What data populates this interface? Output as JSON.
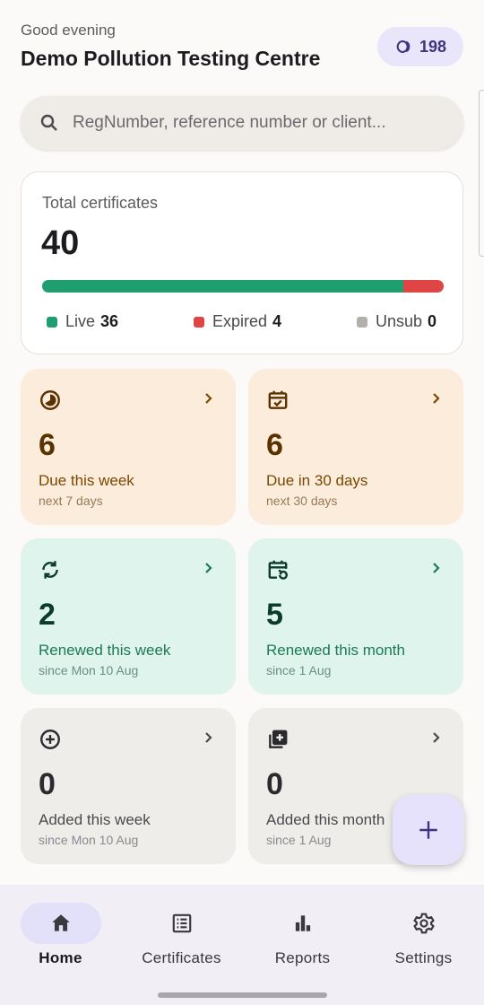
{
  "header": {
    "greeting": "Good evening",
    "centre_name": "Demo Pollution Testing Centre",
    "credits": "198"
  },
  "search": {
    "placeholder": "RegNumber, reference number or client..."
  },
  "total_card": {
    "label": "Total certificates",
    "value": "40",
    "breakdown": [
      {
        "name": "Live",
        "count": 36,
        "color": "#1f9e6f"
      },
      {
        "name": "Expired",
        "count": 4,
        "color": "#e04545"
      },
      {
        "name": "Unsub",
        "count": 0,
        "color": "#b3b0ab"
      }
    ],
    "legend": {
      "live_label": "Live",
      "live_count": "36",
      "expired_label": "Expired",
      "expired_count": "4",
      "unsub_label": "Unsub",
      "unsub_count": "0"
    }
  },
  "tiles": [
    {
      "icon": "clock-pie-icon",
      "value": "6",
      "label": "Due this week",
      "sub": "next 7 days",
      "tone": "orange"
    },
    {
      "icon": "calendar-check-icon",
      "value": "6",
      "label": "Due in 30 days",
      "sub": "next 30 days",
      "tone": "orange"
    },
    {
      "icon": "sync-icon",
      "value": "2",
      "label": "Renewed this week",
      "sub": "since Mon 10 Aug",
      "tone": "green"
    },
    {
      "icon": "calendar-refresh-icon",
      "value": "5",
      "label": "Renewed this month",
      "sub": "since 1 Aug",
      "tone": "green"
    },
    {
      "icon": "add-circle-icon",
      "value": "0",
      "label": "Added this week",
      "sub": "since Mon 10 Aug",
      "tone": "grey"
    },
    {
      "icon": "library-add-icon",
      "value": "0",
      "label": "Added this month",
      "sub": "since 1 Aug",
      "tone": "grey"
    }
  ],
  "colors": {
    "accent": "#e6e2fb",
    "live": "#1f9e6f",
    "expired": "#e04545",
    "unsub": "#b3b0ab",
    "due_tile": "#fbecdc",
    "renewed_tile": "#dff4ec",
    "added_tile": "#efedea"
  },
  "nav": {
    "home": "Home",
    "certificates": "Certificates",
    "reports": "Reports",
    "settings": "Settings",
    "active": "Home"
  }
}
